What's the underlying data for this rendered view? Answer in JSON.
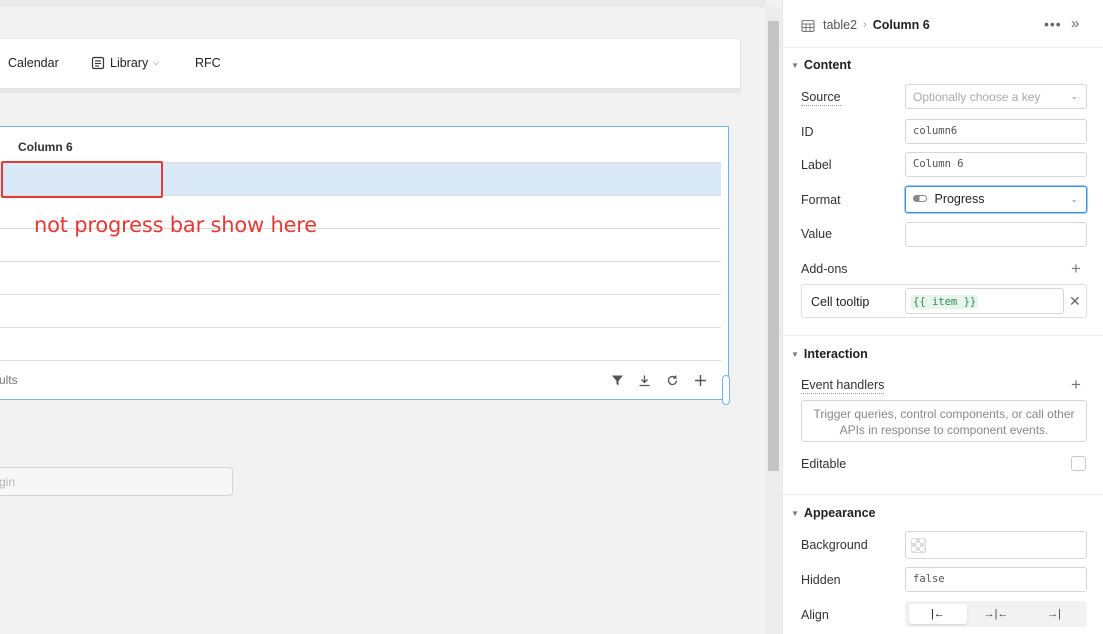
{
  "nav": {
    "calendar": "Calendar",
    "library": "Library",
    "rfc": "RFC"
  },
  "table": {
    "column_header": "Column 6",
    "footer_results": "ults",
    "row_count": 6
  },
  "annotation": {
    "text": "not progress bar show here"
  },
  "login_input": {
    "placeholder": "gin"
  },
  "inspector": {
    "breadcrumb": {
      "parent": "table2",
      "current": "Column 6"
    },
    "content": {
      "title": "Content",
      "source": {
        "label": "Source",
        "placeholder": "Optionally choose a key"
      },
      "id": {
        "label": "ID",
        "value": "column6"
      },
      "label": {
        "label": "Label",
        "value": "Column 6"
      },
      "format": {
        "label": "Format",
        "value": "Progress"
      },
      "value": {
        "label": "Value",
        "value": ""
      },
      "addons": {
        "label": "Add-ons"
      },
      "cell_tooltip": {
        "label": "Cell tooltip",
        "value": "{{ item }}"
      }
    },
    "interaction": {
      "title": "Interaction",
      "event_handlers": {
        "label": "Event handlers",
        "empty": "Trigger queries, control components, or call other APIs in response to component events."
      },
      "editable": {
        "label": "Editable",
        "checked": false
      }
    },
    "appearance": {
      "title": "Appearance",
      "background": {
        "label": "Background"
      },
      "hidden": {
        "label": "Hidden",
        "value": "false"
      },
      "align": {
        "label": "Align",
        "options": [
          "left",
          "center",
          "right"
        ],
        "selected": "left"
      }
    }
  },
  "colors": {
    "annotation": "#e53935",
    "selection": "#d9e9f7",
    "accent": "#3a8bd9",
    "token": "#2e8b57"
  }
}
